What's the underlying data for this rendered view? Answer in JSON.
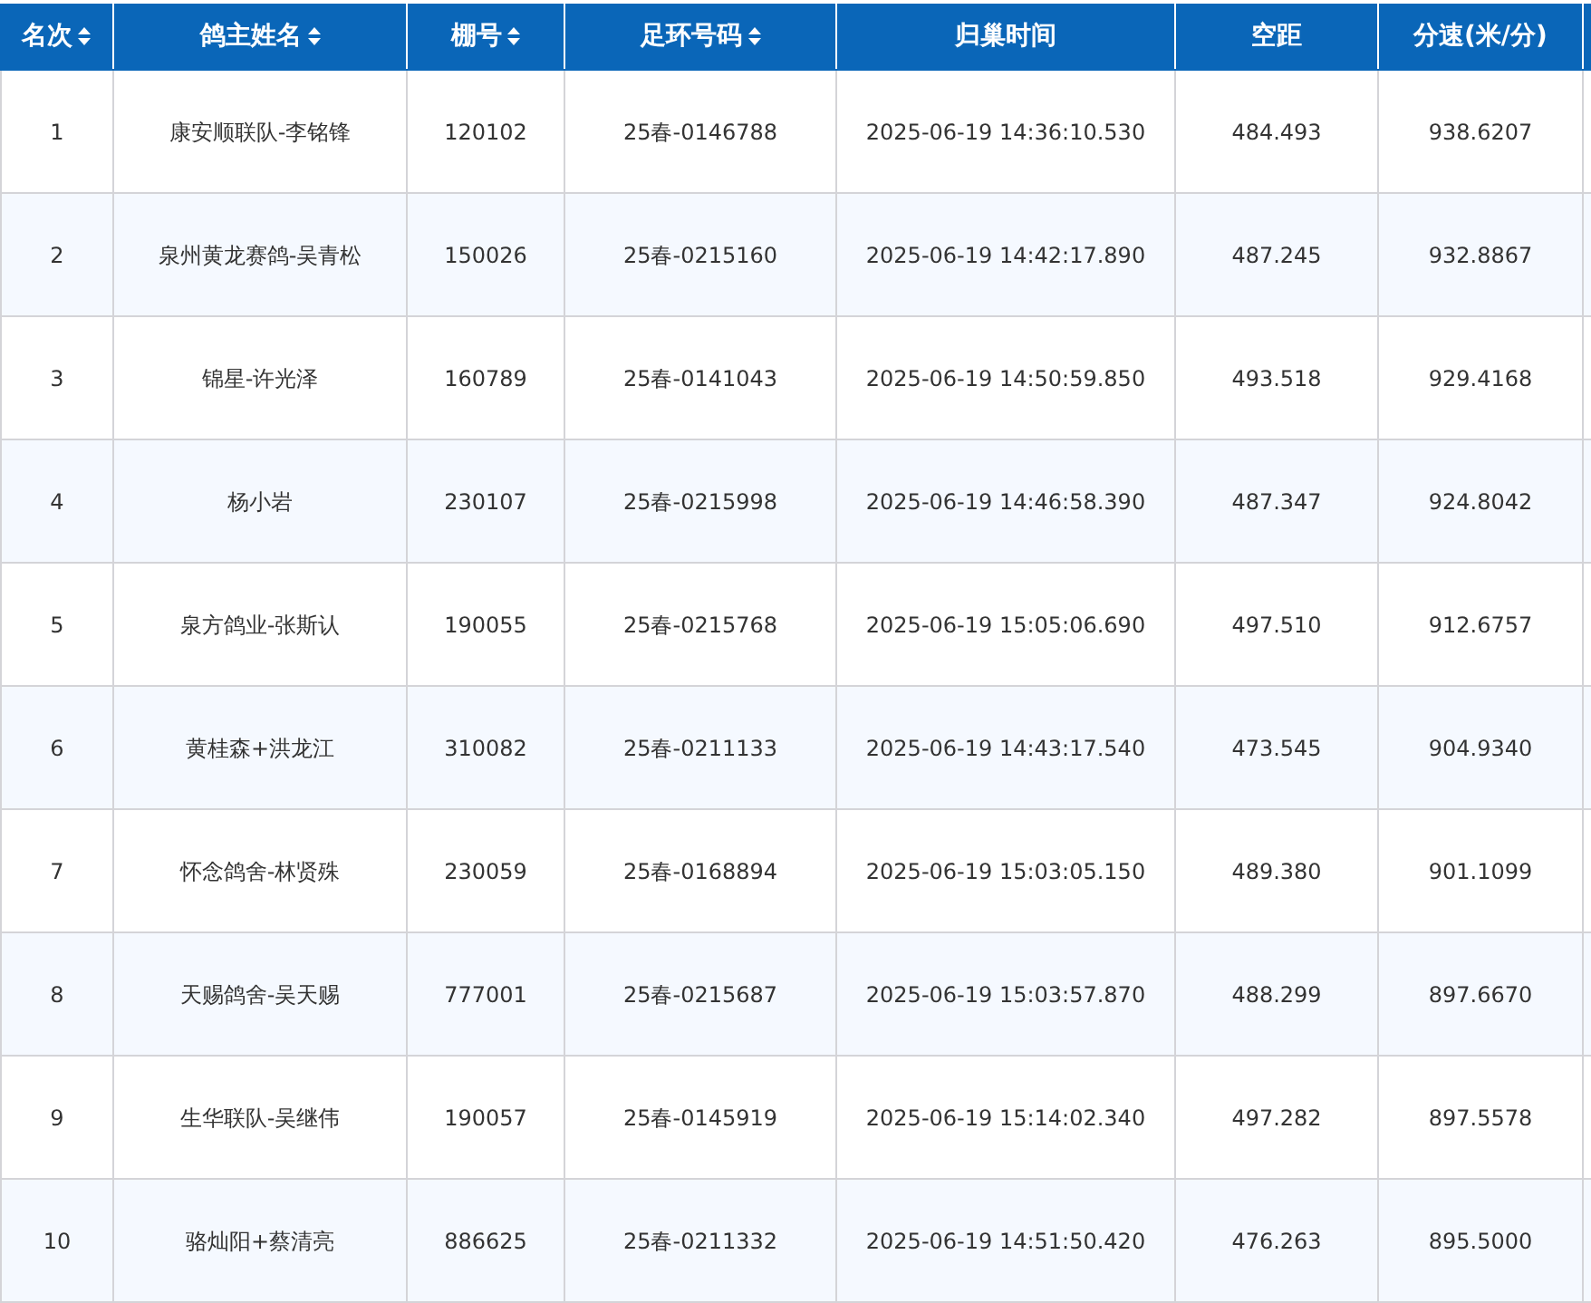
{
  "table": {
    "columns": [
      {
        "label": "名次",
        "sortable": true
      },
      {
        "label": "鸽主姓名",
        "sortable": true
      },
      {
        "label": "棚号",
        "sortable": true
      },
      {
        "label": "足环号码",
        "sortable": true
      },
      {
        "label": "归巢时间",
        "sortable": false
      },
      {
        "label": "空距",
        "sortable": false
      },
      {
        "label": "分速(米/分)",
        "sortable": false
      }
    ],
    "rows": [
      [
        "1",
        "康安顺联队-李铭锋",
        "120102",
        "25春-0146788",
        "2025-06-19 14:36:10.530",
        "484.493",
        "938.6207"
      ],
      [
        "2",
        "泉州黄龙赛鸽-吴青松",
        "150026",
        "25春-0215160",
        "2025-06-19 14:42:17.890",
        "487.245",
        "932.8867"
      ],
      [
        "3",
        "锦星-许光泽",
        "160789",
        "25春-0141043",
        "2025-06-19 14:50:59.850",
        "493.518",
        "929.4168"
      ],
      [
        "4",
        "杨小岩",
        "230107",
        "25春-0215998",
        "2025-06-19 14:46:58.390",
        "487.347",
        "924.8042"
      ],
      [
        "5",
        "泉方鸽业-张斯认",
        "190055",
        "25春-0215768",
        "2025-06-19 15:05:06.690",
        "497.510",
        "912.6757"
      ],
      [
        "6",
        "黄桂森+洪龙江",
        "310082",
        "25春-0211133",
        "2025-06-19 14:43:17.540",
        "473.545",
        "904.9340"
      ],
      [
        "7",
        "怀念鸽舍-林贤殊",
        "230059",
        "25春-0168894",
        "2025-06-19 15:03:05.150",
        "489.380",
        "901.1099"
      ],
      [
        "8",
        "天赐鸽舍-吴天赐",
        "777001",
        "25春-0215687",
        "2025-06-19 15:03:57.870",
        "488.299",
        "897.6670"
      ],
      [
        "9",
        "生华联队-吴继伟",
        "190057",
        "25春-0145919",
        "2025-06-19 15:14:02.340",
        "497.282",
        "897.5578"
      ],
      [
        "10",
        "骆灿阳+蔡清亮",
        "886625",
        "25春-0211332",
        "2025-06-19 14:51:50.420",
        "476.263",
        "895.5000"
      ]
    ]
  }
}
